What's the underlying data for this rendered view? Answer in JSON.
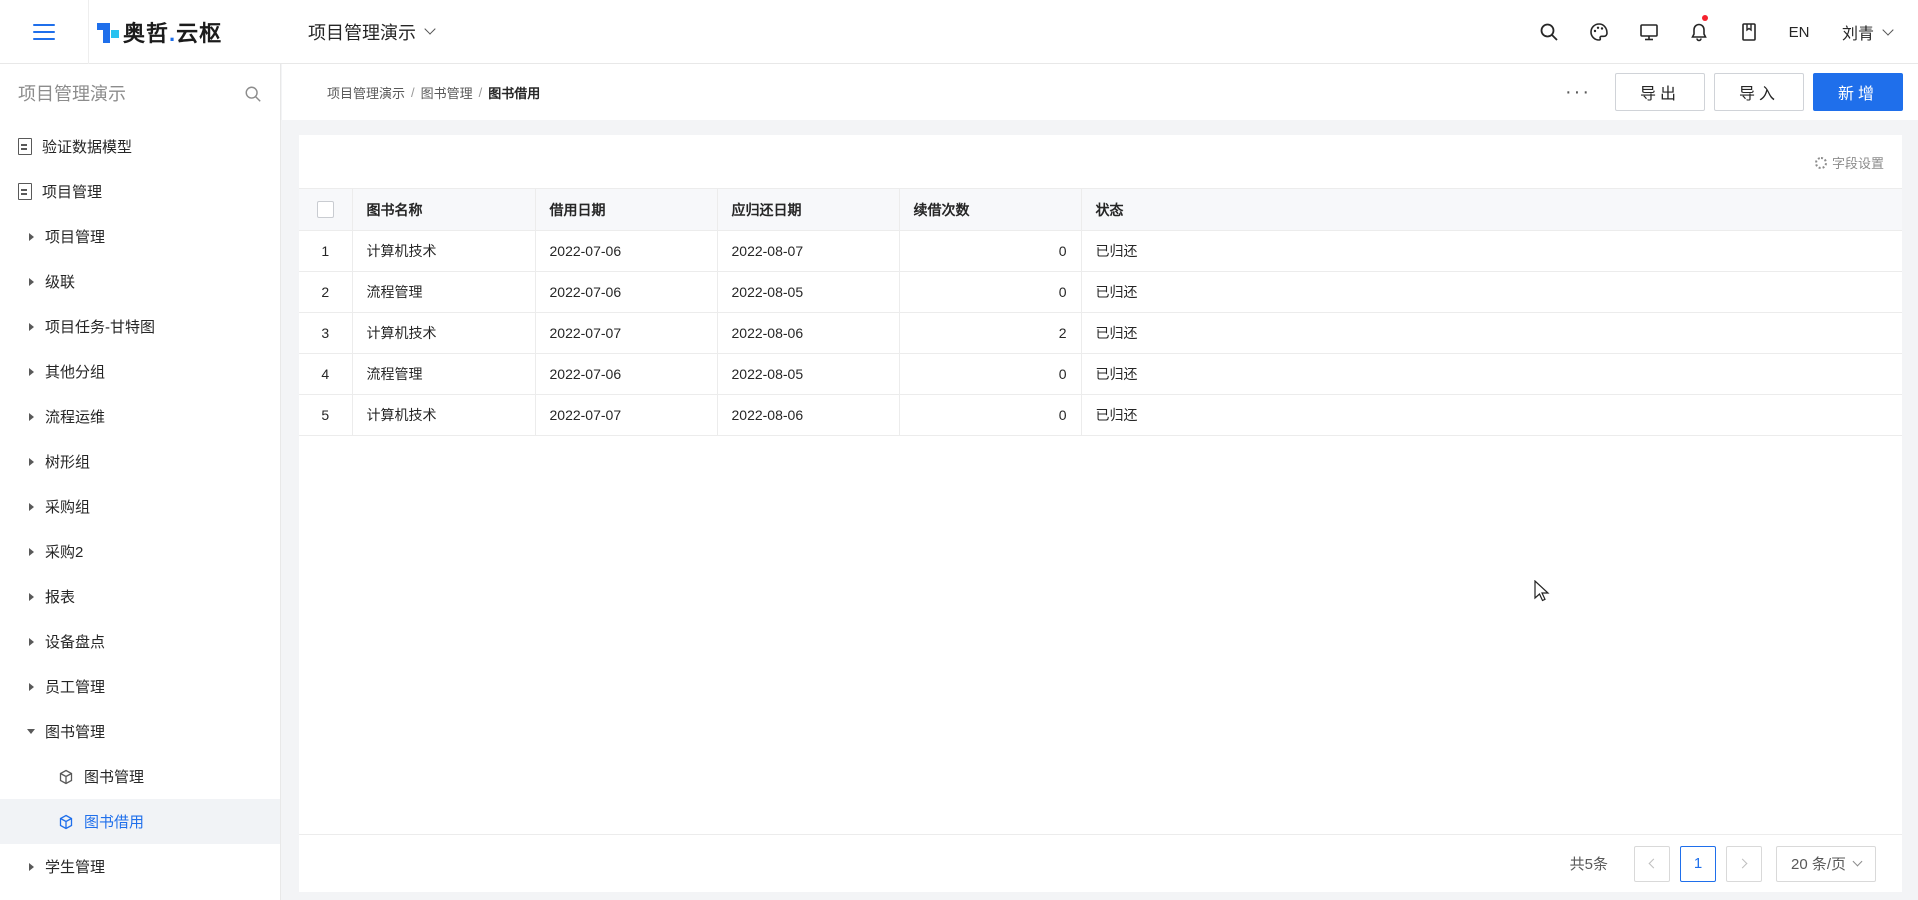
{
  "header": {
    "logo_text_main": "奥哲",
    "logo_text_dot": ".",
    "logo_text_tail": "云枢",
    "app_name": "项目管理演示",
    "lang": "EN",
    "user": "刘青",
    "icons": [
      "search-icon",
      "theme-icon",
      "monitor-icon",
      "bell-icon",
      "bookmark-icon"
    ]
  },
  "sidebar": {
    "search_placeholder": "项目管理演示",
    "items": [
      {
        "label": "验证数据模型",
        "type": "doc"
      },
      {
        "label": "项目管理",
        "type": "doc"
      },
      {
        "label": "项目管理",
        "type": "group"
      },
      {
        "label": "级联",
        "type": "group"
      },
      {
        "label": "项目任务-甘特图",
        "type": "group"
      },
      {
        "label": "其他分组",
        "type": "group"
      },
      {
        "label": "流程运维",
        "type": "group"
      },
      {
        "label": "树形组",
        "type": "group"
      },
      {
        "label": "采购组",
        "type": "group"
      },
      {
        "label": "采购2",
        "type": "group"
      },
      {
        "label": "报表",
        "type": "group"
      },
      {
        "label": "设备盘点",
        "type": "group"
      },
      {
        "label": "员工管理",
        "type": "group"
      },
      {
        "label": "图书管理",
        "type": "group-open"
      },
      {
        "label": "图书管理",
        "type": "child"
      },
      {
        "label": "图书借用",
        "type": "child-active"
      },
      {
        "label": "学生管理",
        "type": "group"
      }
    ]
  },
  "breadcrumb": [
    "项目管理演示",
    "图书管理",
    "图书借用"
  ],
  "breadcrumb_sep": "/",
  "toolbar": {
    "more": "···",
    "export": "导出",
    "import": "导入",
    "add": "新增"
  },
  "table": {
    "field_settings": "字段设置",
    "columns": [
      "图书名称",
      "借用日期",
      "应归还日期",
      "续借次数",
      "状态"
    ],
    "rows": [
      {
        "idx": "1",
        "name": "计算机技术",
        "borrow": "2022-07-06",
        "due": "2022-08-07",
        "renew": "0",
        "status": "已归还"
      },
      {
        "idx": "2",
        "name": "流程管理",
        "borrow": "2022-07-06",
        "due": "2022-08-05",
        "renew": "0",
        "status": "已归还"
      },
      {
        "idx": "3",
        "name": "计算机技术",
        "borrow": "2022-07-07",
        "due": "2022-08-06",
        "renew": "2",
        "status": "已归还"
      },
      {
        "idx": "4",
        "name": "流程管理",
        "borrow": "2022-07-06",
        "due": "2022-08-05",
        "renew": "0",
        "status": "已归还"
      },
      {
        "idx": "5",
        "name": "计算机技术",
        "borrow": "2022-07-07",
        "due": "2022-08-06",
        "renew": "0",
        "status": "已归还"
      }
    ]
  },
  "pagination": {
    "total": "共5条",
    "current_page": "1",
    "page_size": "20 条/页"
  },
  "colors": {
    "primary": "#1f6feb",
    "notification_dot": "#f5222d"
  }
}
